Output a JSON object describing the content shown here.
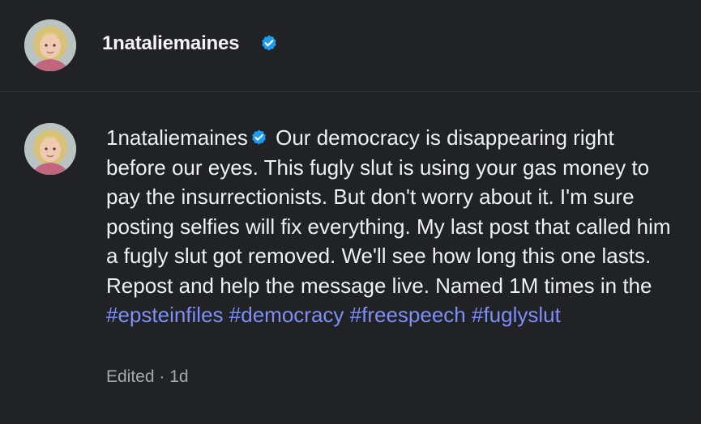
{
  "header": {
    "username": "1nataliemaines",
    "avatar_icon": "profile-avatar",
    "verified_icon": "verified-badge-icon"
  },
  "post": {
    "author": "1nataliemaines",
    "text": "Our democracy is disappearing right before our eyes. This fugly slut is using your gas money to pay the insurrectionists. But don't worry about it. I'm sure posting selfies will fix everything. My last post that called him a fugly slut got removed. We'll see how long this one lasts. Repost and help the message live. Named 1M times in the",
    "hashtags": [
      "#epsteinfiles",
      "#democracy",
      "#freespeech",
      "#fuglyslut"
    ],
    "meta": "Edited · 1d"
  },
  "colors": {
    "background": "#212226",
    "text": "#eef0f2",
    "hashtag": "#7d8ff5",
    "meta": "#a4a7ad",
    "verified": "#1d9bf0"
  }
}
